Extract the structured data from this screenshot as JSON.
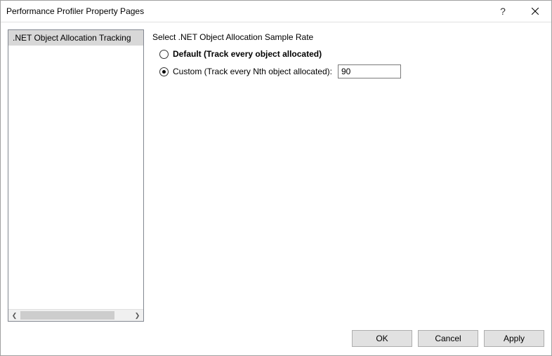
{
  "window": {
    "title": "Performance Profiler Property Pages"
  },
  "sidebar": {
    "items": [
      {
        "label": ".NET Object Allocation Tracking",
        "selected": true
      }
    ]
  },
  "content": {
    "section_label": "Select .NET Object Allocation Sample Rate",
    "options": {
      "default": {
        "label": "Default (Track every object allocated)",
        "selected": false
      },
      "custom": {
        "label": "Custom (Track every Nth object allocated):",
        "selected": true,
        "value": "90"
      }
    }
  },
  "footer": {
    "ok": "OK",
    "cancel": "Cancel",
    "apply": "Apply"
  },
  "titlebar": {
    "help": "?",
    "close": "×"
  }
}
